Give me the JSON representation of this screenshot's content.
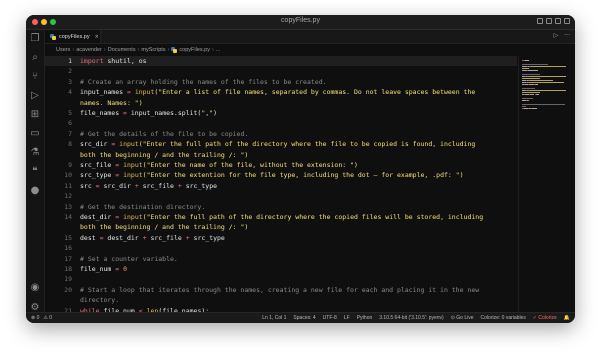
{
  "window": {
    "title": "copyFiles.py"
  },
  "tab": {
    "label": "copyFiles.py",
    "close_glyph": "×"
  },
  "tab_actions": {
    "run": "▷",
    "more": "···"
  },
  "breadcrumb": [
    "Users",
    "acavender",
    "Documents",
    "myScripts",
    "copyFiles.py",
    "..."
  ],
  "editor": {
    "lines": [
      {
        "n": "1",
        "parts": [
          [
            "kw",
            "import"
          ],
          [
            "id",
            " shutil, os"
          ]
        ]
      },
      {
        "n": "2",
        "parts": []
      },
      {
        "n": "3",
        "parts": [
          [
            "cm",
            "# Create an array holding the names of the files to be created."
          ]
        ]
      },
      {
        "n": "4",
        "parts": [
          [
            "id",
            "input_names "
          ],
          [
            "op",
            "="
          ],
          [
            "id",
            " "
          ],
          [
            "fn",
            "input"
          ],
          [
            "str",
            "(\"Enter a list of file names, separated by commas. Do not leave spaces between the"
          ]
        ]
      },
      {
        "n": "",
        "parts": [
          [
            "str",
            "names. Names: \")"
          ]
        ]
      },
      {
        "n": "5",
        "parts": [
          [
            "id",
            "file_names "
          ],
          [
            "op",
            "="
          ],
          [
            "id",
            " input_names.split("
          ],
          [
            "str",
            "\",\""
          ],
          [
            "id",
            ")"
          ]
        ]
      },
      {
        "n": "6",
        "parts": []
      },
      {
        "n": "7",
        "parts": [
          [
            "cm",
            "# Get the details of the file to be copied."
          ]
        ]
      },
      {
        "n": "8",
        "parts": [
          [
            "id",
            "src_dir "
          ],
          [
            "op",
            "="
          ],
          [
            "id",
            " "
          ],
          [
            "fn",
            "input"
          ],
          [
            "str",
            "(\"Enter the full path of the directory where the file to be copied is found, including"
          ]
        ]
      },
      {
        "n": "",
        "parts": [
          [
            "str",
            "both the beginning / and the trailing /: \")"
          ]
        ]
      },
      {
        "n": "9",
        "parts": [
          [
            "id",
            "src_file "
          ],
          [
            "op",
            "="
          ],
          [
            "id",
            " "
          ],
          [
            "fn",
            "input"
          ],
          [
            "str",
            "(\"Enter the name of the file, without the extension: \")"
          ]
        ]
      },
      {
        "n": "10",
        "parts": [
          [
            "id",
            "src_type "
          ],
          [
            "op",
            "="
          ],
          [
            "id",
            " "
          ],
          [
            "fn",
            "input"
          ],
          [
            "str",
            "(\"Enter the extention for the file type, including the dot — for example, .pdf: \")"
          ]
        ]
      },
      {
        "n": "11",
        "parts": [
          [
            "id",
            "src "
          ],
          [
            "op",
            "="
          ],
          [
            "id",
            " src_dir "
          ],
          [
            "op",
            "+"
          ],
          [
            "id",
            " src_file "
          ],
          [
            "op",
            "+"
          ],
          [
            "id",
            " src_type"
          ]
        ]
      },
      {
        "n": "12",
        "parts": []
      },
      {
        "n": "13",
        "parts": [
          [
            "cm",
            "# Get the destination directory."
          ]
        ]
      },
      {
        "n": "14",
        "parts": [
          [
            "id",
            "dest_dir "
          ],
          [
            "op",
            "="
          ],
          [
            "id",
            " "
          ],
          [
            "fn",
            "input"
          ],
          [
            "str",
            "(\"Enter the full path of the directory where the copied files will be stored, including"
          ]
        ]
      },
      {
        "n": "",
        "parts": [
          [
            "str",
            "both the beginning / and the trailing /: \")"
          ]
        ]
      },
      {
        "n": "15",
        "parts": [
          [
            "id",
            "dest "
          ],
          [
            "op",
            "="
          ],
          [
            "id",
            " dest_dir "
          ],
          [
            "op",
            "+"
          ],
          [
            "id",
            " src_file "
          ],
          [
            "op",
            "+"
          ],
          [
            "id",
            " src_type"
          ]
        ]
      },
      {
        "n": "16",
        "parts": []
      },
      {
        "n": "17",
        "parts": [
          [
            "cm",
            "# Set a counter variable."
          ]
        ]
      },
      {
        "n": "18",
        "parts": [
          [
            "id",
            "file_num "
          ],
          [
            "op",
            "="
          ],
          [
            "id",
            " "
          ],
          [
            "num",
            "0"
          ]
        ]
      },
      {
        "n": "19",
        "parts": []
      },
      {
        "n": "20",
        "parts": [
          [
            "cm",
            "# Start a loop that iterates through the names, creating a new file for each and placing it in the new"
          ]
        ]
      },
      {
        "n": "",
        "parts": [
          [
            "cm",
            "directory."
          ]
        ]
      },
      {
        "n": "21",
        "parts": [
          [
            "kw",
            "while"
          ],
          [
            "id",
            " file_num "
          ],
          [
            "op",
            "<"
          ],
          [
            "id",
            " "
          ],
          [
            "fn",
            "len"
          ],
          [
            "id",
            "(file_names):"
          ]
        ]
      }
    ]
  },
  "status": {
    "left": [
      "⊗ 0",
      "⚠ 0"
    ],
    "position": "Ln 1, Col 1",
    "spaces": "Spaces: 4",
    "encoding": "UTF-8",
    "eol": "LF",
    "language": "Python",
    "interpreter": "3.10.5 64-bit ('3.10.5': pyenv)",
    "golive": "⊙ Go Live",
    "colorize_vars": "Colorize: 0 variables",
    "colorize": "✓ Colorize",
    "bell": "🔔"
  },
  "activity_icons": [
    "files-icon",
    "search-icon",
    "source-control-icon",
    "run-debug-icon",
    "extensions-icon",
    "remote-icon",
    "testing-icon",
    "quote-icon",
    "github-icon",
    "account-icon",
    "settings-icon"
  ]
}
